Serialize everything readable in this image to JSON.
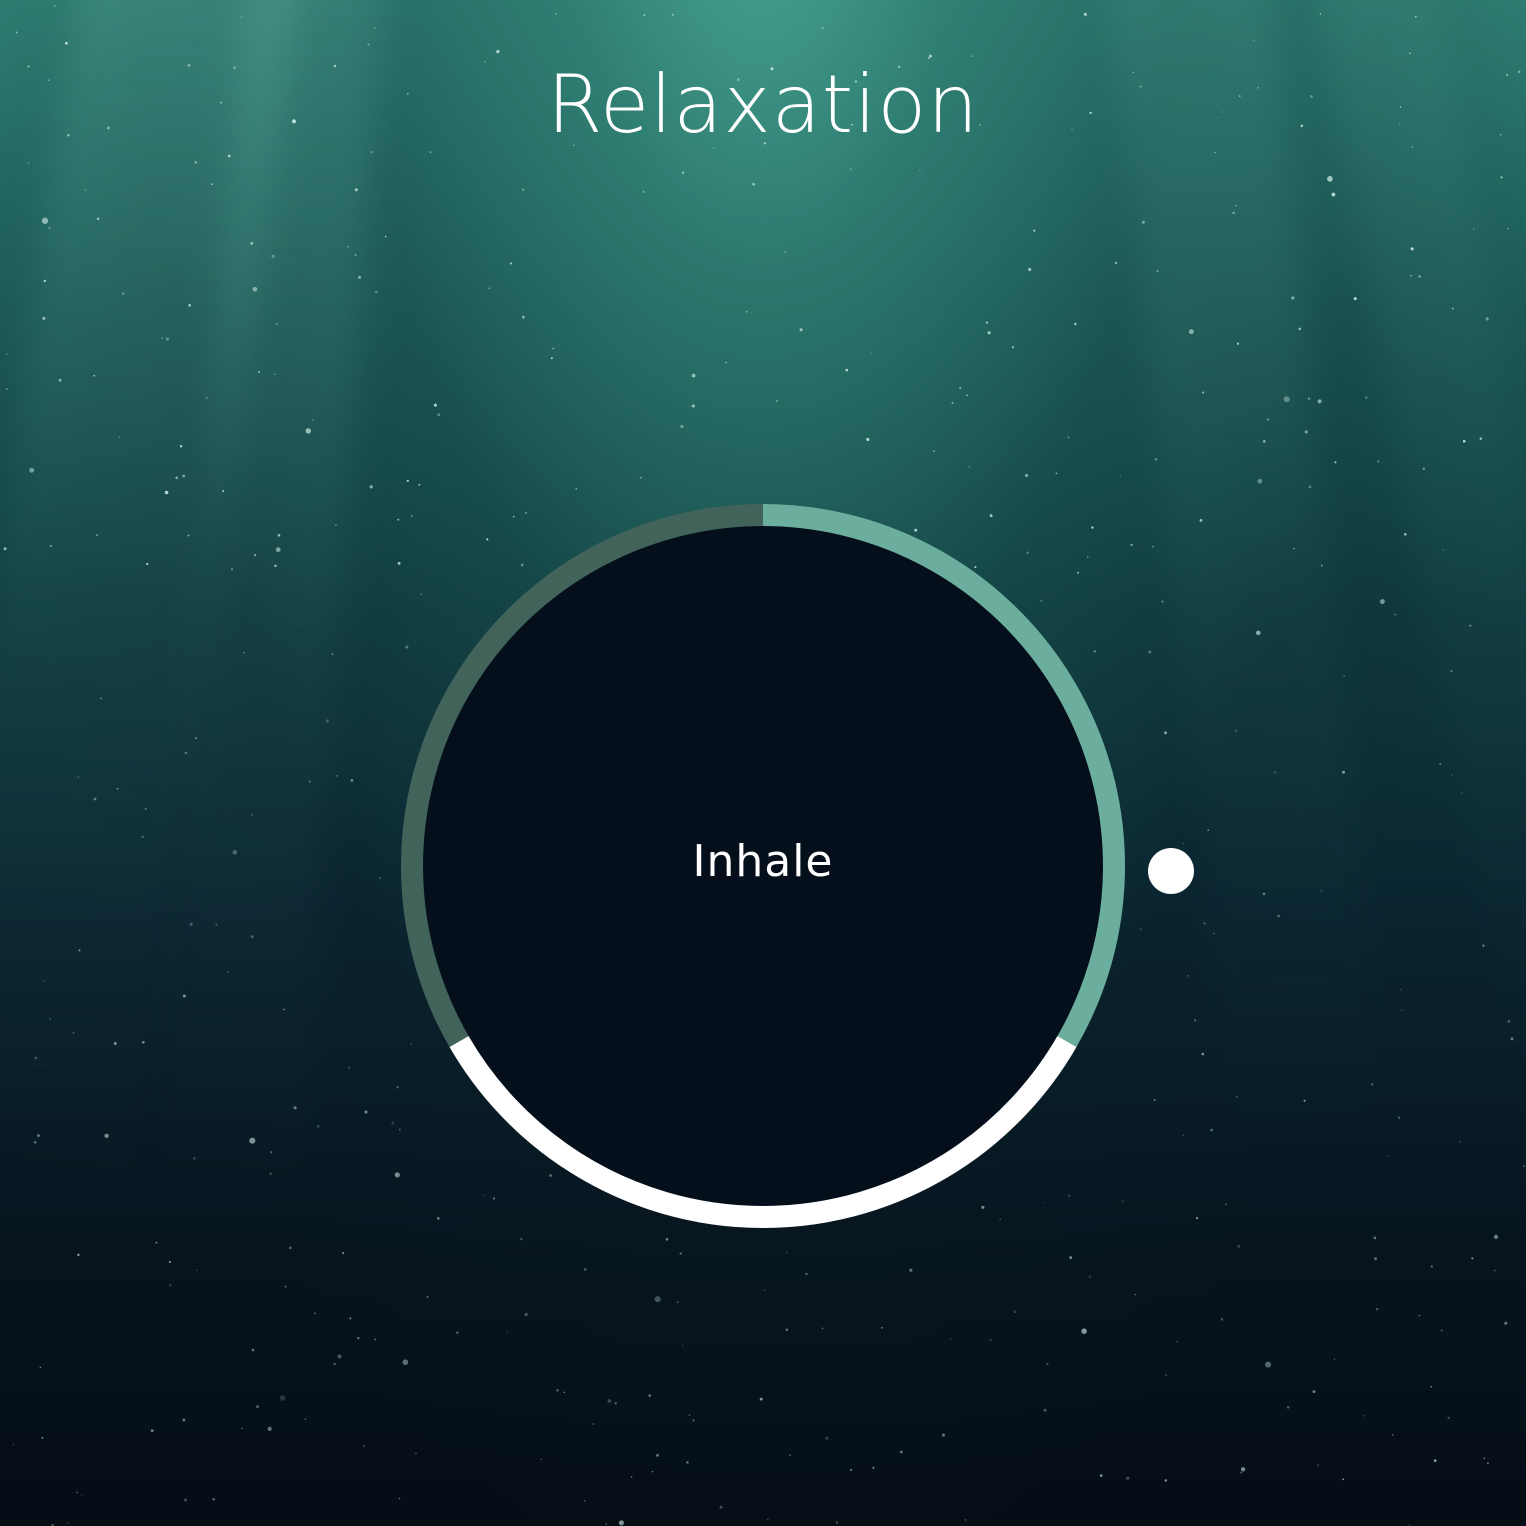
{
  "app": {
    "title": "Relaxation"
  },
  "breathing": {
    "phase_label": "Inhale",
    "segments": [
      {
        "name": "inhale",
        "start_deg": 0,
        "end_deg": 120,
        "color": "#6cae9e"
      },
      {
        "name": "hold",
        "start_deg": 120,
        "end_deg": 240,
        "color": "#ffffff"
      },
      {
        "name": "exhale",
        "start_deg": 240,
        "end_deg": 360,
        "color": "#41635a"
      }
    ],
    "progress_fraction": 0.25,
    "colors": {
      "ring_track": "#41635a",
      "ring_inhale": "#6cae9e",
      "ring_hold": "#ffffff",
      "center_fill": "#050f1c",
      "indicator": "#ffffff"
    }
  },
  "icons": {
    "progress_indicator": "dot-indicator-icon"
  }
}
